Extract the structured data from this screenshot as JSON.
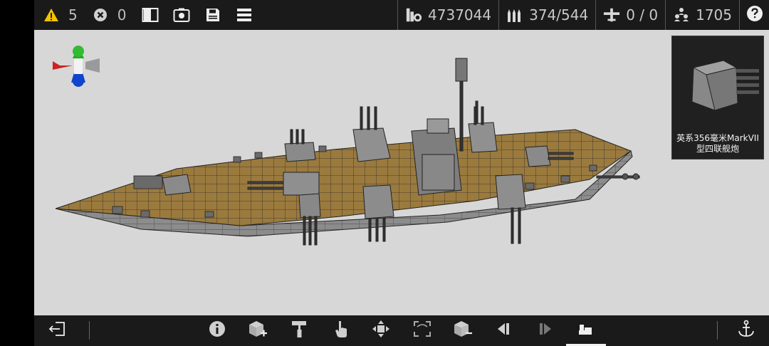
{
  "topbar": {
    "warnings_count": "5",
    "errors_count": "0",
    "stats": {
      "cost": "4737044",
      "ammo": "374/544",
      "aircraft": "0 / 0",
      "crew": "1705"
    }
  },
  "preview": {
    "label_line1": "英系356毫米MarkVII",
    "label_line2": "型四联舰炮"
  },
  "colors": {
    "deck": "#9b7a3e",
    "hull": "#8d8d8d",
    "viewport_bg": "#d7d7d7",
    "warning": "#f2c300"
  },
  "bottombar": {
    "buttons": [
      "exit-icon",
      "info-icon",
      "add-part-icon",
      "paint-roller-icon",
      "hand-icon",
      "move-icon",
      "rotate-icon",
      "remove-part-icon",
      "undo-icon",
      "redo-icon",
      "ship-view-icon",
      "anchor-icon"
    ]
  }
}
